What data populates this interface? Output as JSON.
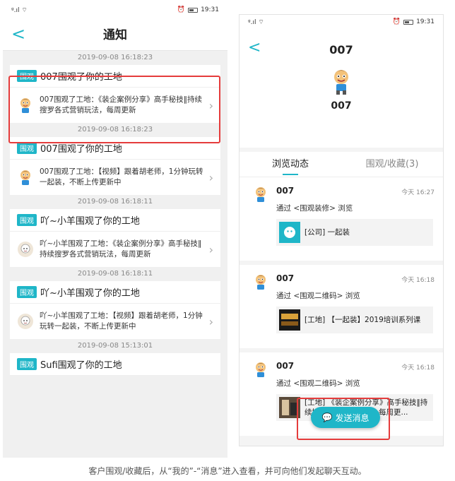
{
  "left": {
    "status_time": "19:31",
    "nav_title": "通知",
    "back_icon": "back-chevron-icon",
    "notifications": [
      {
        "time": "2019-09-08 16:18:23",
        "tag": "围观",
        "title": "007围观了你的工地",
        "desc": "007围观了工地：《装企案例分享》高手秘技‖持续搜罗各式营销玩法，每周更新"
      },
      {
        "time": "2019-09-08 16:18:23",
        "tag": "围观",
        "title": "007围观了你的工地",
        "desc": "007围观了工地：【视频】跟着胡老师，1分钟玩转一起装，不断上传更新中"
      },
      {
        "time": "2019-09-08 16:18:11",
        "tag": "围观",
        "title": "吖~小羊围观了你的工地",
        "desc": "吖~小羊围观了工地：《装企案例分享》高手秘技‖持续搜罗各式营销玩法，每周更新"
      },
      {
        "time": "2019-09-08 16:18:11",
        "tag": "围观",
        "title": "吖~小羊围观了你的工地",
        "desc": "吖~小羊围观了工地：【视频】跟着胡老师，1分钟玩转一起装，不断上传更新中"
      },
      {
        "time": "2019-09-08 15:13:01",
        "tag": "围观",
        "title": "Sufi围观了你的工地",
        "desc": ""
      }
    ]
  },
  "right": {
    "status_time": "19:31",
    "title": "007",
    "name": "007",
    "tabs": [
      "浏览动态",
      "围观/收藏(3)"
    ],
    "feed": [
      {
        "name": "007",
        "time": "今天 16:27",
        "via": "通过 <围观装修> 浏览",
        "link": "[公司] 一起装"
      },
      {
        "name": "007",
        "time": "今天 16:18",
        "via": "通过 <围观二维码> 浏览",
        "link": "[工地] 【一起装】2019培训系列课"
      },
      {
        "name": "007",
        "time": "今天 16:18",
        "via": "通过 <围观二维码> 浏览",
        "link": "[工地] 《装企案例分享》高手秘技‖持续搜罗各式营销玩法，每周更..."
      }
    ],
    "send_button": "发送消息"
  },
  "caption": "客户围观/收藏后，从“我的”-“消息”进入查看，并可向他们发起聊天互动。",
  "colors": {
    "accent": "#1fb6c8",
    "highlight": "#e53c3c"
  }
}
